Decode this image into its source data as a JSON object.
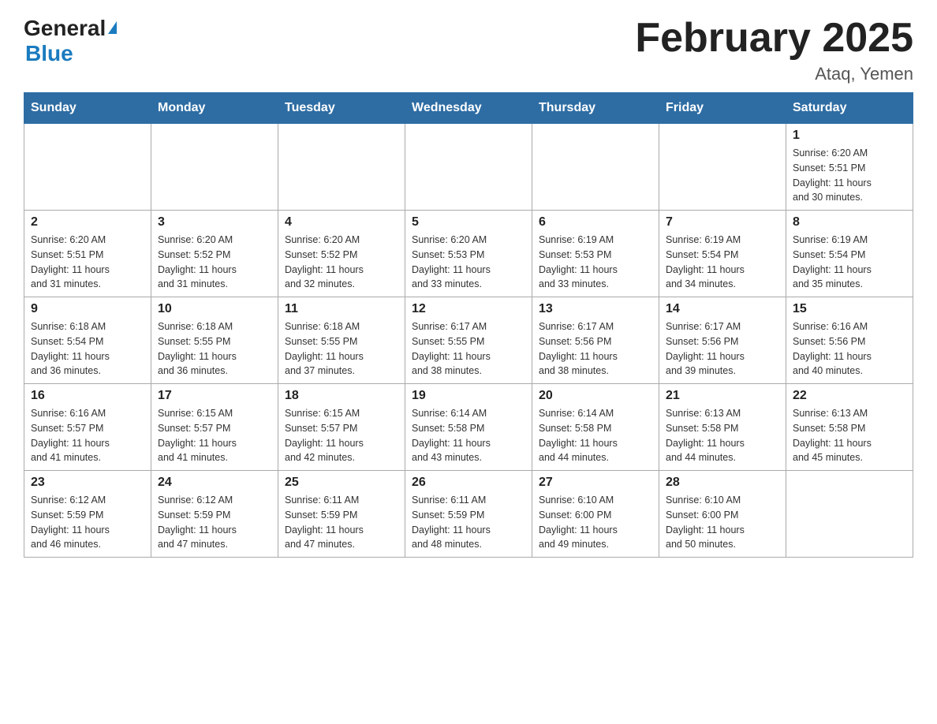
{
  "header": {
    "logo_general": "General",
    "logo_blue": "Blue",
    "month_title": "February 2025",
    "location": "Ataq, Yemen"
  },
  "days_of_week": [
    "Sunday",
    "Monday",
    "Tuesday",
    "Wednesday",
    "Thursday",
    "Friday",
    "Saturday"
  ],
  "weeks": [
    [
      {
        "day": "",
        "info": ""
      },
      {
        "day": "",
        "info": ""
      },
      {
        "day": "",
        "info": ""
      },
      {
        "day": "",
        "info": ""
      },
      {
        "day": "",
        "info": ""
      },
      {
        "day": "",
        "info": ""
      },
      {
        "day": "1",
        "info": "Sunrise: 6:20 AM\nSunset: 5:51 PM\nDaylight: 11 hours\nand 30 minutes."
      }
    ],
    [
      {
        "day": "2",
        "info": "Sunrise: 6:20 AM\nSunset: 5:51 PM\nDaylight: 11 hours\nand 31 minutes."
      },
      {
        "day": "3",
        "info": "Sunrise: 6:20 AM\nSunset: 5:52 PM\nDaylight: 11 hours\nand 31 minutes."
      },
      {
        "day": "4",
        "info": "Sunrise: 6:20 AM\nSunset: 5:52 PM\nDaylight: 11 hours\nand 32 minutes."
      },
      {
        "day": "5",
        "info": "Sunrise: 6:20 AM\nSunset: 5:53 PM\nDaylight: 11 hours\nand 33 minutes."
      },
      {
        "day": "6",
        "info": "Sunrise: 6:19 AM\nSunset: 5:53 PM\nDaylight: 11 hours\nand 33 minutes."
      },
      {
        "day": "7",
        "info": "Sunrise: 6:19 AM\nSunset: 5:54 PM\nDaylight: 11 hours\nand 34 minutes."
      },
      {
        "day": "8",
        "info": "Sunrise: 6:19 AM\nSunset: 5:54 PM\nDaylight: 11 hours\nand 35 minutes."
      }
    ],
    [
      {
        "day": "9",
        "info": "Sunrise: 6:18 AM\nSunset: 5:54 PM\nDaylight: 11 hours\nand 36 minutes."
      },
      {
        "day": "10",
        "info": "Sunrise: 6:18 AM\nSunset: 5:55 PM\nDaylight: 11 hours\nand 36 minutes."
      },
      {
        "day": "11",
        "info": "Sunrise: 6:18 AM\nSunset: 5:55 PM\nDaylight: 11 hours\nand 37 minutes."
      },
      {
        "day": "12",
        "info": "Sunrise: 6:17 AM\nSunset: 5:55 PM\nDaylight: 11 hours\nand 38 minutes."
      },
      {
        "day": "13",
        "info": "Sunrise: 6:17 AM\nSunset: 5:56 PM\nDaylight: 11 hours\nand 38 minutes."
      },
      {
        "day": "14",
        "info": "Sunrise: 6:17 AM\nSunset: 5:56 PM\nDaylight: 11 hours\nand 39 minutes."
      },
      {
        "day": "15",
        "info": "Sunrise: 6:16 AM\nSunset: 5:56 PM\nDaylight: 11 hours\nand 40 minutes."
      }
    ],
    [
      {
        "day": "16",
        "info": "Sunrise: 6:16 AM\nSunset: 5:57 PM\nDaylight: 11 hours\nand 41 minutes."
      },
      {
        "day": "17",
        "info": "Sunrise: 6:15 AM\nSunset: 5:57 PM\nDaylight: 11 hours\nand 41 minutes."
      },
      {
        "day": "18",
        "info": "Sunrise: 6:15 AM\nSunset: 5:57 PM\nDaylight: 11 hours\nand 42 minutes."
      },
      {
        "day": "19",
        "info": "Sunrise: 6:14 AM\nSunset: 5:58 PM\nDaylight: 11 hours\nand 43 minutes."
      },
      {
        "day": "20",
        "info": "Sunrise: 6:14 AM\nSunset: 5:58 PM\nDaylight: 11 hours\nand 44 minutes."
      },
      {
        "day": "21",
        "info": "Sunrise: 6:13 AM\nSunset: 5:58 PM\nDaylight: 11 hours\nand 44 minutes."
      },
      {
        "day": "22",
        "info": "Sunrise: 6:13 AM\nSunset: 5:58 PM\nDaylight: 11 hours\nand 45 minutes."
      }
    ],
    [
      {
        "day": "23",
        "info": "Sunrise: 6:12 AM\nSunset: 5:59 PM\nDaylight: 11 hours\nand 46 minutes."
      },
      {
        "day": "24",
        "info": "Sunrise: 6:12 AM\nSunset: 5:59 PM\nDaylight: 11 hours\nand 47 minutes."
      },
      {
        "day": "25",
        "info": "Sunrise: 6:11 AM\nSunset: 5:59 PM\nDaylight: 11 hours\nand 47 minutes."
      },
      {
        "day": "26",
        "info": "Sunrise: 6:11 AM\nSunset: 5:59 PM\nDaylight: 11 hours\nand 48 minutes."
      },
      {
        "day": "27",
        "info": "Sunrise: 6:10 AM\nSunset: 6:00 PM\nDaylight: 11 hours\nand 49 minutes."
      },
      {
        "day": "28",
        "info": "Sunrise: 6:10 AM\nSunset: 6:00 PM\nDaylight: 11 hours\nand 50 minutes."
      },
      {
        "day": "",
        "info": ""
      }
    ]
  ]
}
